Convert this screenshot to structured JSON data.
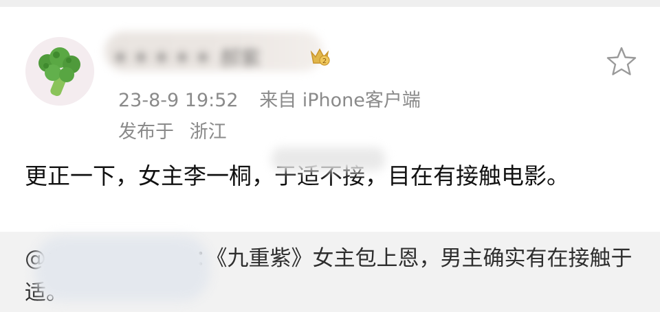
{
  "post": {
    "username": "＊＊＊＊＊ 郝紫",
    "timestamp": "23-8-9 19:52",
    "source": "来自 iPhone客户端",
    "location_label": "发布于",
    "location": "浙江",
    "body": "更正一下，女主李一桐，于适不接，目在有接触电影。"
  },
  "repost": {
    "text": "@＊＊＊＊＊＊＊：《九重紫》女主包上恩，男主确实有在接触于适。"
  },
  "icons": {
    "avatar": "broccoli-avatar",
    "badge": "vip-badge-icon",
    "favorite": "star-outline-icon"
  },
  "colors": {
    "meta_text": "#8a8a8a",
    "repost_bg": "#f2f2f2",
    "badge_gold": "#e0b64a"
  }
}
